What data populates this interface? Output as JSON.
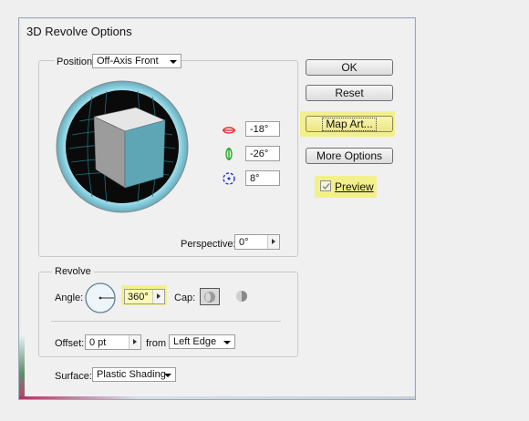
{
  "dialog": {
    "title": "3D Revolve Options",
    "position": {
      "label": "Position",
      "select": "Off-Axis Front",
      "rot_x": "-18°",
      "rot_y": "-26°",
      "rot_z": "8°",
      "perspective_label": "Perspective",
      "perspective": "0°"
    },
    "revolve": {
      "label": "Revolve",
      "angle_label": "Angle",
      "angle": "360°",
      "cap_label": "Cap",
      "offset_label": "Offset",
      "offset": "0 pt",
      "from_label": "from",
      "from": "Left Edge"
    },
    "surface_label": "Surface",
    "surface": "Plastic Shading",
    "buttons": {
      "ok": "OK",
      "reset": "Reset",
      "map_art": "Map Art...",
      "more_options": "More Options"
    },
    "preview_label": "Preview",
    "preview_checked": true
  },
  "colors": {
    "highlight": "#f4f06a",
    "cube_side": "#5ea6b6",
    "trackball_ring": "#8ad3e3"
  },
  "icons": [
    "rotate-x-icon",
    "rotate-y-icon",
    "rotate-z-icon",
    "cap-on-icon",
    "cap-off-icon",
    "angle-dial-icon"
  ]
}
